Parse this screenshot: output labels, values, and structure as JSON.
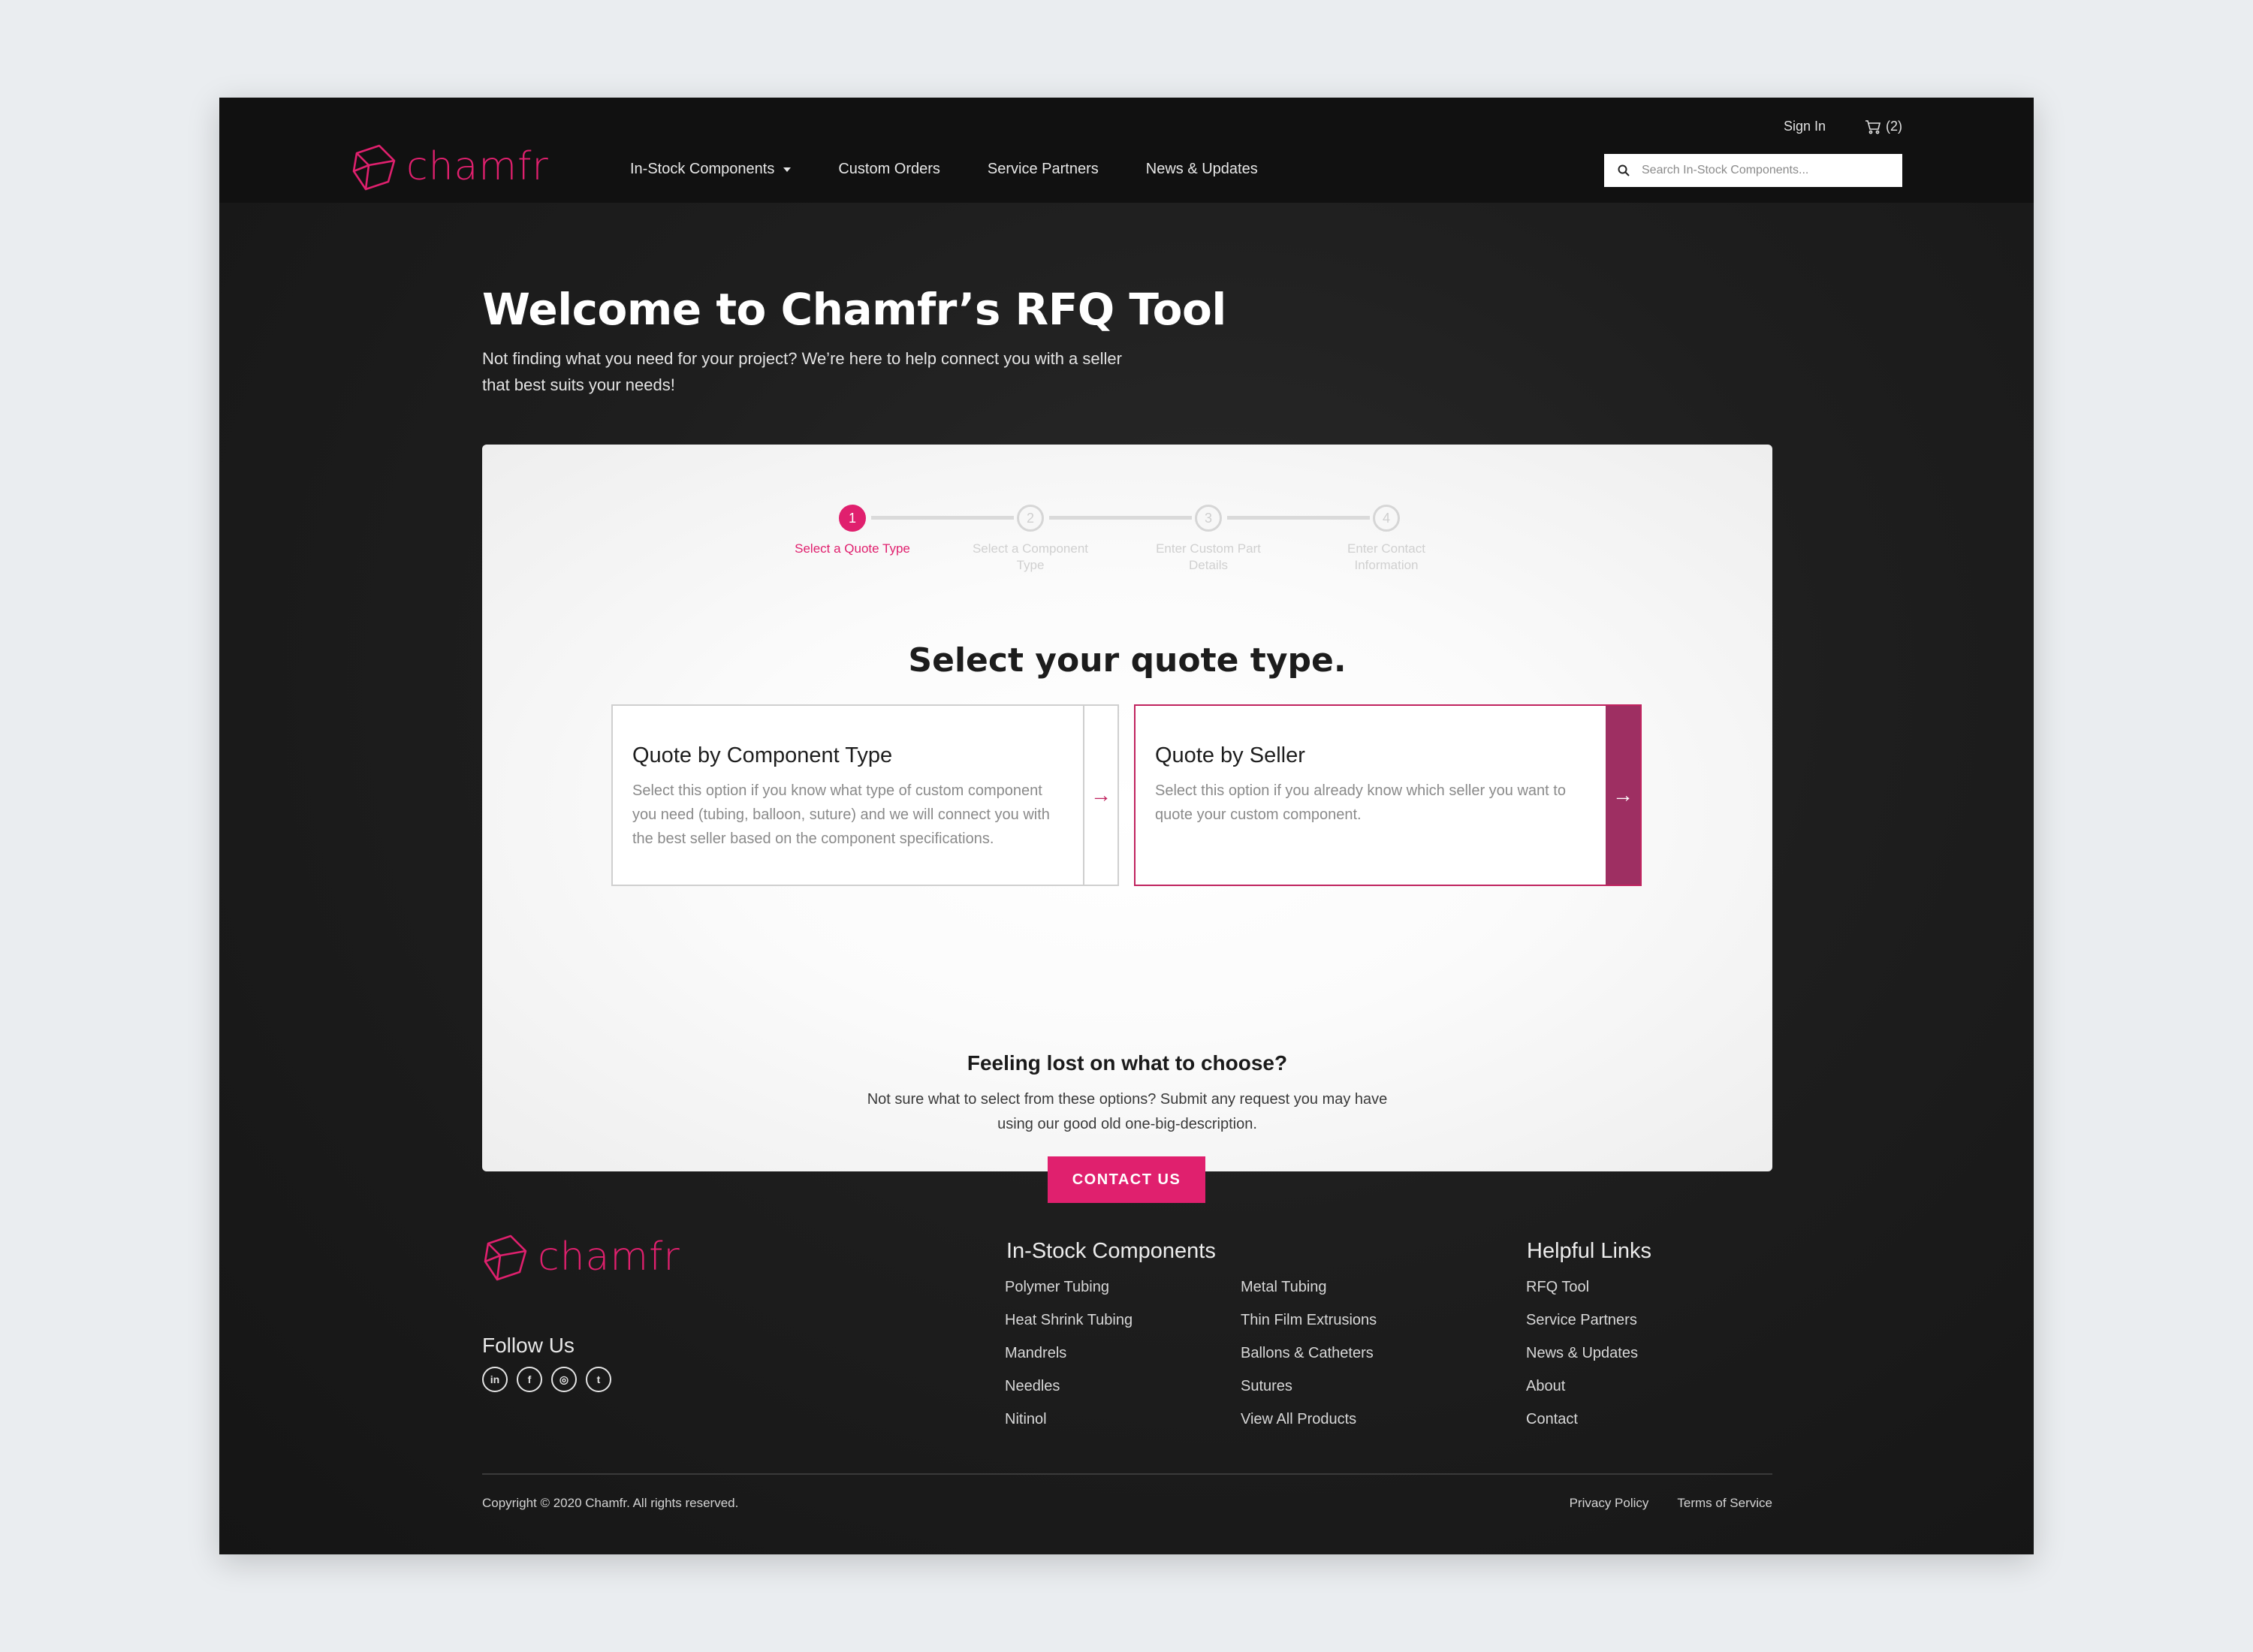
{
  "header": {
    "logo_text": "chamfr",
    "nav": [
      {
        "label": "In-Stock Components",
        "has_dropdown": true
      },
      {
        "label": "Custom Orders"
      },
      {
        "label": "Service Partners"
      },
      {
        "label": "News & Updates"
      }
    ],
    "sign_in": "Sign In",
    "cart_count": "(2)",
    "search_placeholder": "Search In-Stock Components..."
  },
  "hero": {
    "title": "Welcome to Chamfr’s RFQ Tool",
    "subtitle": "Not finding what you need for your project? We’re here to help connect you with a seller that best suits your needs!"
  },
  "stepper": {
    "active_step": 1,
    "steps": [
      {
        "number": "1",
        "label": "Select a Quote Type"
      },
      {
        "number": "2",
        "label": "Select a Component Type"
      },
      {
        "number": "3",
        "label": "Enter Custom Part Details"
      },
      {
        "number": "4",
        "label": "Enter Contact Information"
      }
    ]
  },
  "quote": {
    "heading": "Select your quote type.",
    "options": [
      {
        "title": "Quote by Component Type",
        "description": "Select this option if you know what type of custom component you need (tubing, balloon, suture) and we will connect you with the best seller based on the component specifications.",
        "arrow": "→"
      },
      {
        "title": "Quote by Seller",
        "description": "Select this option if you already know which seller you want to quote your custom component.",
        "arrow": "→"
      }
    ]
  },
  "help": {
    "title": "Feeling lost on what to choose?",
    "description": "Not sure what to select from these options? Submit any request you may have using our good old one-big-description.",
    "button": "CONTACT US"
  },
  "footer": {
    "logo_text": "chamfr",
    "follow_title": "Follow Us",
    "social": [
      {
        "name": "linkedin-icon",
        "glyph": "in"
      },
      {
        "name": "facebook-icon",
        "glyph": "f"
      },
      {
        "name": "instagram-icon",
        "glyph": "◎"
      },
      {
        "name": "twitter-icon",
        "glyph": "t"
      }
    ],
    "components_title": "In-Stock Components",
    "components_col1": [
      "Polymer Tubing",
      "Heat Shrink Tubing",
      "Mandrels",
      "Needles",
      "Nitinol"
    ],
    "components_col2": [
      "Metal Tubing",
      "Thin Film Extrusions",
      "Ballons & Catheters",
      "Sutures",
      "View All Products"
    ],
    "helpful_title": "Helpful Links",
    "helpful": [
      "RFQ Tool",
      "Service Partners",
      "News & Updates",
      "About",
      "Contact"
    ],
    "copyright": "Copyright © 2020 Chamfr. All rights reserved.",
    "legal": [
      "Privacy Policy",
      "Terms of Service"
    ]
  },
  "colors": {
    "accent": "#e0206e",
    "accent_dark": "#9e2f62",
    "page_bg": "#eaedf0",
    "frame_bg": "#1e1e1e"
  }
}
